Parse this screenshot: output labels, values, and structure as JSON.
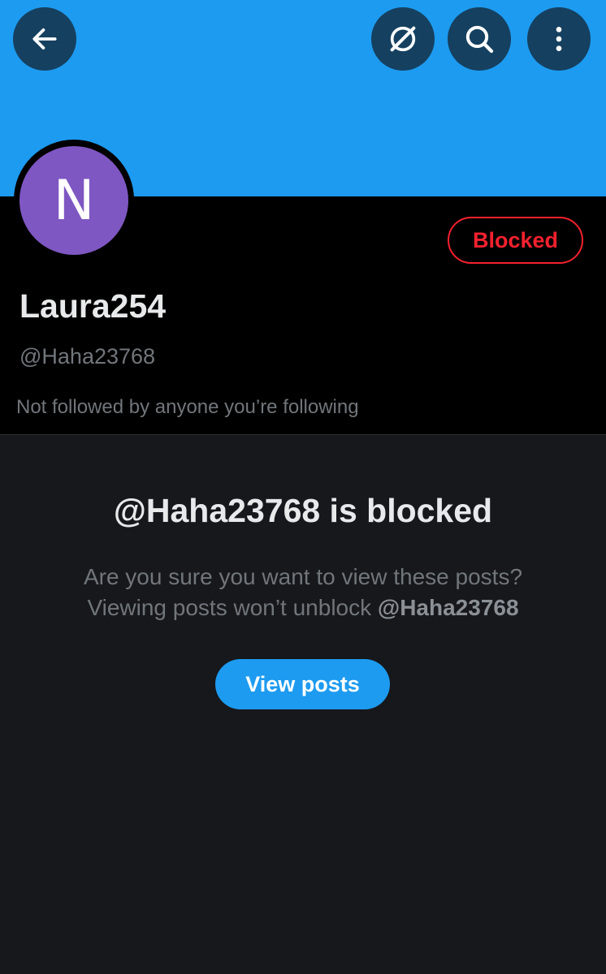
{
  "header": {
    "back_icon": "arrow-left-icon",
    "grok_icon": "grok-icon",
    "search_icon": "search-icon",
    "more_icon": "more-vertical-icon",
    "banner_color": "#1d9bf0"
  },
  "profile": {
    "avatar_initial": "N",
    "avatar_color": "#7e57c2",
    "display_name": "Laura254",
    "handle": "@Haha23768",
    "followed_note": "Not followed by anyone you’re following",
    "blocked_button_label": "Blocked",
    "blocked_color": "#f4212e"
  },
  "blocked_notice": {
    "title": "@Haha23768 is blocked",
    "line1": "Are you sure you want to view these posts?",
    "line2_prefix": "Viewing posts won’t unblock ",
    "line2_handle": "@Haha23768",
    "view_button_label": "View posts"
  }
}
